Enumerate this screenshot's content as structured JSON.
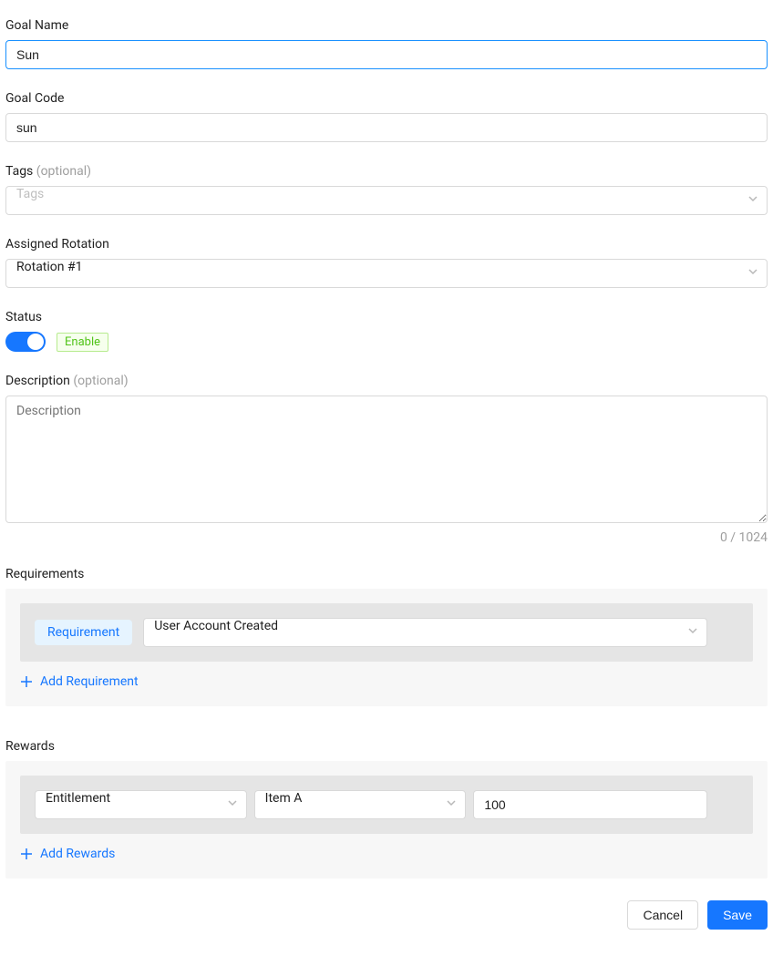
{
  "goalName": {
    "label": "Goal Name",
    "value": "Sun"
  },
  "goalCode": {
    "label": "Goal Code",
    "value": "sun"
  },
  "tags": {
    "label": "Tags",
    "optional": "(optional)",
    "placeholder": "Tags"
  },
  "assignedRotation": {
    "label": "Assigned Rotation",
    "value": "Rotation #1"
  },
  "status": {
    "label": "Status",
    "badge": "Enable"
  },
  "description": {
    "label": "Description",
    "optional": "(optional)",
    "placeholder": "Description",
    "counter": "0 / 1024"
  },
  "requirements": {
    "label": "Requirements",
    "badge": "Requirement",
    "value": "User Account Created",
    "addLabel": "Add Requirement"
  },
  "rewards": {
    "label": "Rewards",
    "type": "Entitlement",
    "item": "Item A",
    "qty": "100",
    "addLabel": "Add Rewards"
  },
  "footer": {
    "cancel": "Cancel",
    "save": "Save"
  }
}
